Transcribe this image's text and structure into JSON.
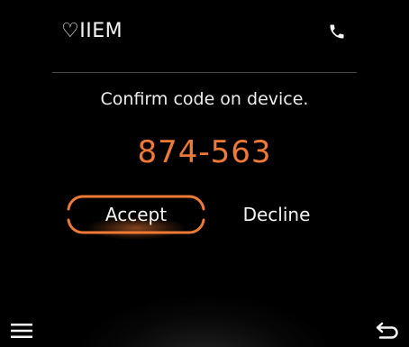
{
  "header": {
    "brand": "♡IIEM",
    "call_icon": "phone-icon"
  },
  "main": {
    "prompt": "Confirm code on device.",
    "code": "874-563"
  },
  "actions": {
    "accept_label": "Accept",
    "decline_label": "Decline"
  },
  "footer": {
    "menu_icon": "menu-icon",
    "back_icon": "back-icon"
  },
  "colors": {
    "background": "#000000",
    "accent": "#f07a35",
    "text": "#f4f4f4",
    "divider": "#4a4a4a"
  }
}
